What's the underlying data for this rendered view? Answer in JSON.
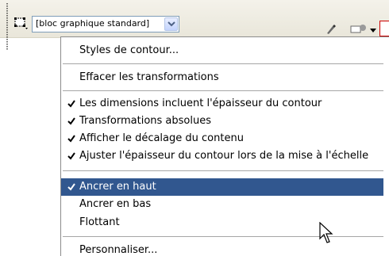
{
  "toolbar": {
    "object_style_value": "[bloc graphique standard]",
    "icons": [
      "frame-tool-icon",
      "chevron-down-icon",
      "pen-icon",
      "settings-icon",
      "dropdown-arrow-icon",
      "stroke-icon"
    ]
  },
  "menu": {
    "stroke_styles": "Styles de contour...",
    "clear_transformations": "Effacer les transformations",
    "dimensions_include_stroke": "Les dimensions incluent l'épaisseur du contour",
    "absolute_transformations": "Transformations absolues",
    "show_content_offset": "Afficher le décalage du contenu",
    "adjust_stroke_scaling": "Ajuster l'épaisseur du contour lors de la mise à l'échelle",
    "dock_top": "Ancrer en haut",
    "dock_bottom": "Ancrer en bas",
    "floating": "Flottant",
    "customize": "Personnaliser..."
  },
  "colors": {
    "highlight": "#31578f",
    "separator": "#a6a6a6"
  }
}
